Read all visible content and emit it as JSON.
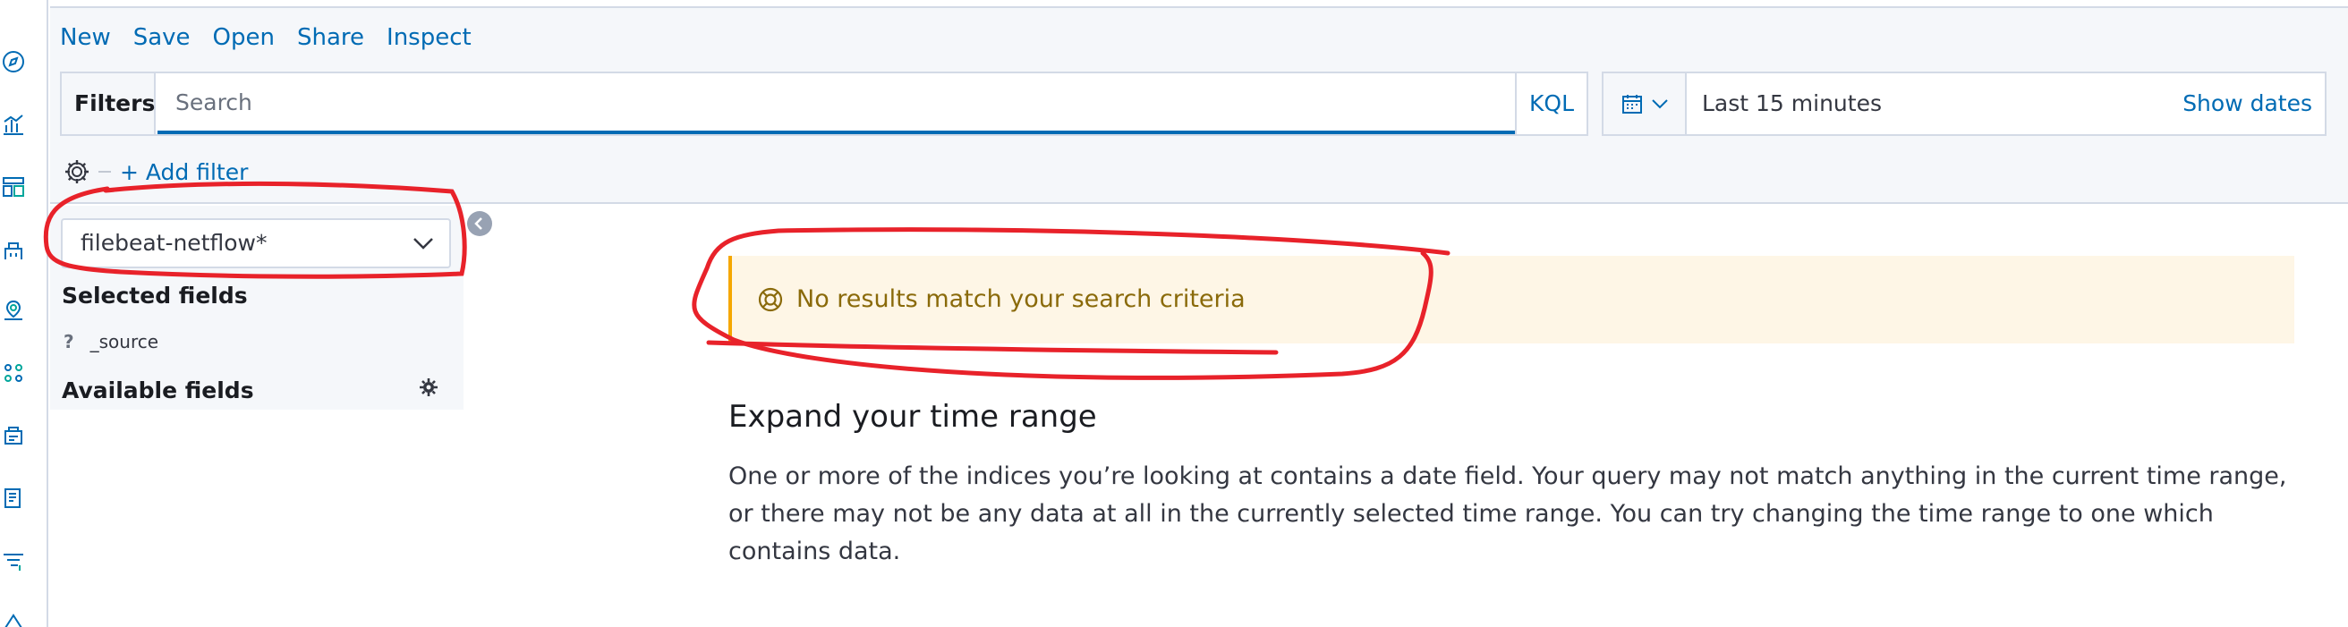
{
  "menu": {
    "new": "New",
    "save": "Save",
    "open": "Open",
    "share": "Share",
    "inspect": "Inspect"
  },
  "query_bar": {
    "filters_label": "Filters",
    "search_placeholder": "Search",
    "language": "KQL"
  },
  "date_picker": {
    "range": "Last 15 minutes",
    "show_dates": "Show dates"
  },
  "filter_bar": {
    "add_filter": "+ Add filter"
  },
  "sidebar": {
    "index_pattern": "filebeat-netflow*",
    "selected_fields_title": "Selected fields",
    "selected_fields": [
      {
        "type": "?",
        "name": "_source"
      }
    ],
    "available_fields_title": "Available fields"
  },
  "callout": {
    "text": "No results match your search criteria"
  },
  "no_results": {
    "title": "Expand your time range",
    "body": "One or more of the indices you’re looking at contains a date field. Your query may not match anything in the current time range, or there may not be any data at all in the currently selected time range. You can try changing the time range to one which contains data."
  },
  "colors": {
    "link": "#006bb4",
    "annotation": "#e8222a",
    "callout_bg": "#fef6e6",
    "callout_border": "#f5a700"
  },
  "rail_icons": [
    "discover-icon",
    "visualize-icon",
    "dashboard-icon",
    "canvas-icon",
    "maps-icon",
    "ml-icon",
    "infrastructure-icon",
    "logs-icon",
    "apm-icon",
    "uptime-icon"
  ]
}
